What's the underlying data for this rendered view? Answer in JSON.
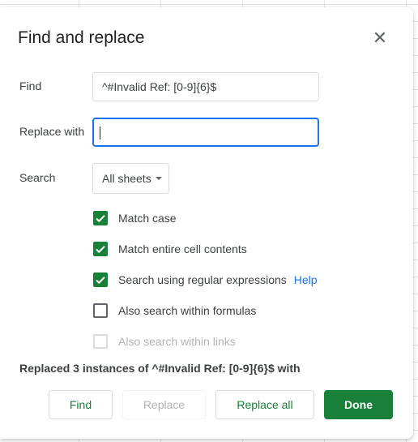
{
  "dialog": {
    "title": "Find and replace",
    "close_icon": "close-icon",
    "find": {
      "label": "Find",
      "value": "^#Invalid Ref: [0-9]{6}$"
    },
    "replace": {
      "label": "Replace with",
      "value": ""
    },
    "search": {
      "label": "Search",
      "selected": "All sheets"
    },
    "options": [
      {
        "label": "Match case",
        "checked": true,
        "disabled": false
      },
      {
        "label": "Match entire cell contents",
        "checked": true,
        "disabled": false
      },
      {
        "label": "Search using regular expressions",
        "checked": true,
        "disabled": false,
        "help": "Help"
      },
      {
        "label": "Also search within formulas",
        "checked": false,
        "disabled": false
      },
      {
        "label": "Also search within links",
        "checked": false,
        "disabled": true
      }
    ],
    "status": "Replaced 3 instances of ^#Invalid Ref: [0-9]{6}$ with",
    "buttons": {
      "find": "Find",
      "replace": "Replace",
      "replace_all": "Replace all",
      "done": "Done"
    },
    "accent": "#188038"
  }
}
